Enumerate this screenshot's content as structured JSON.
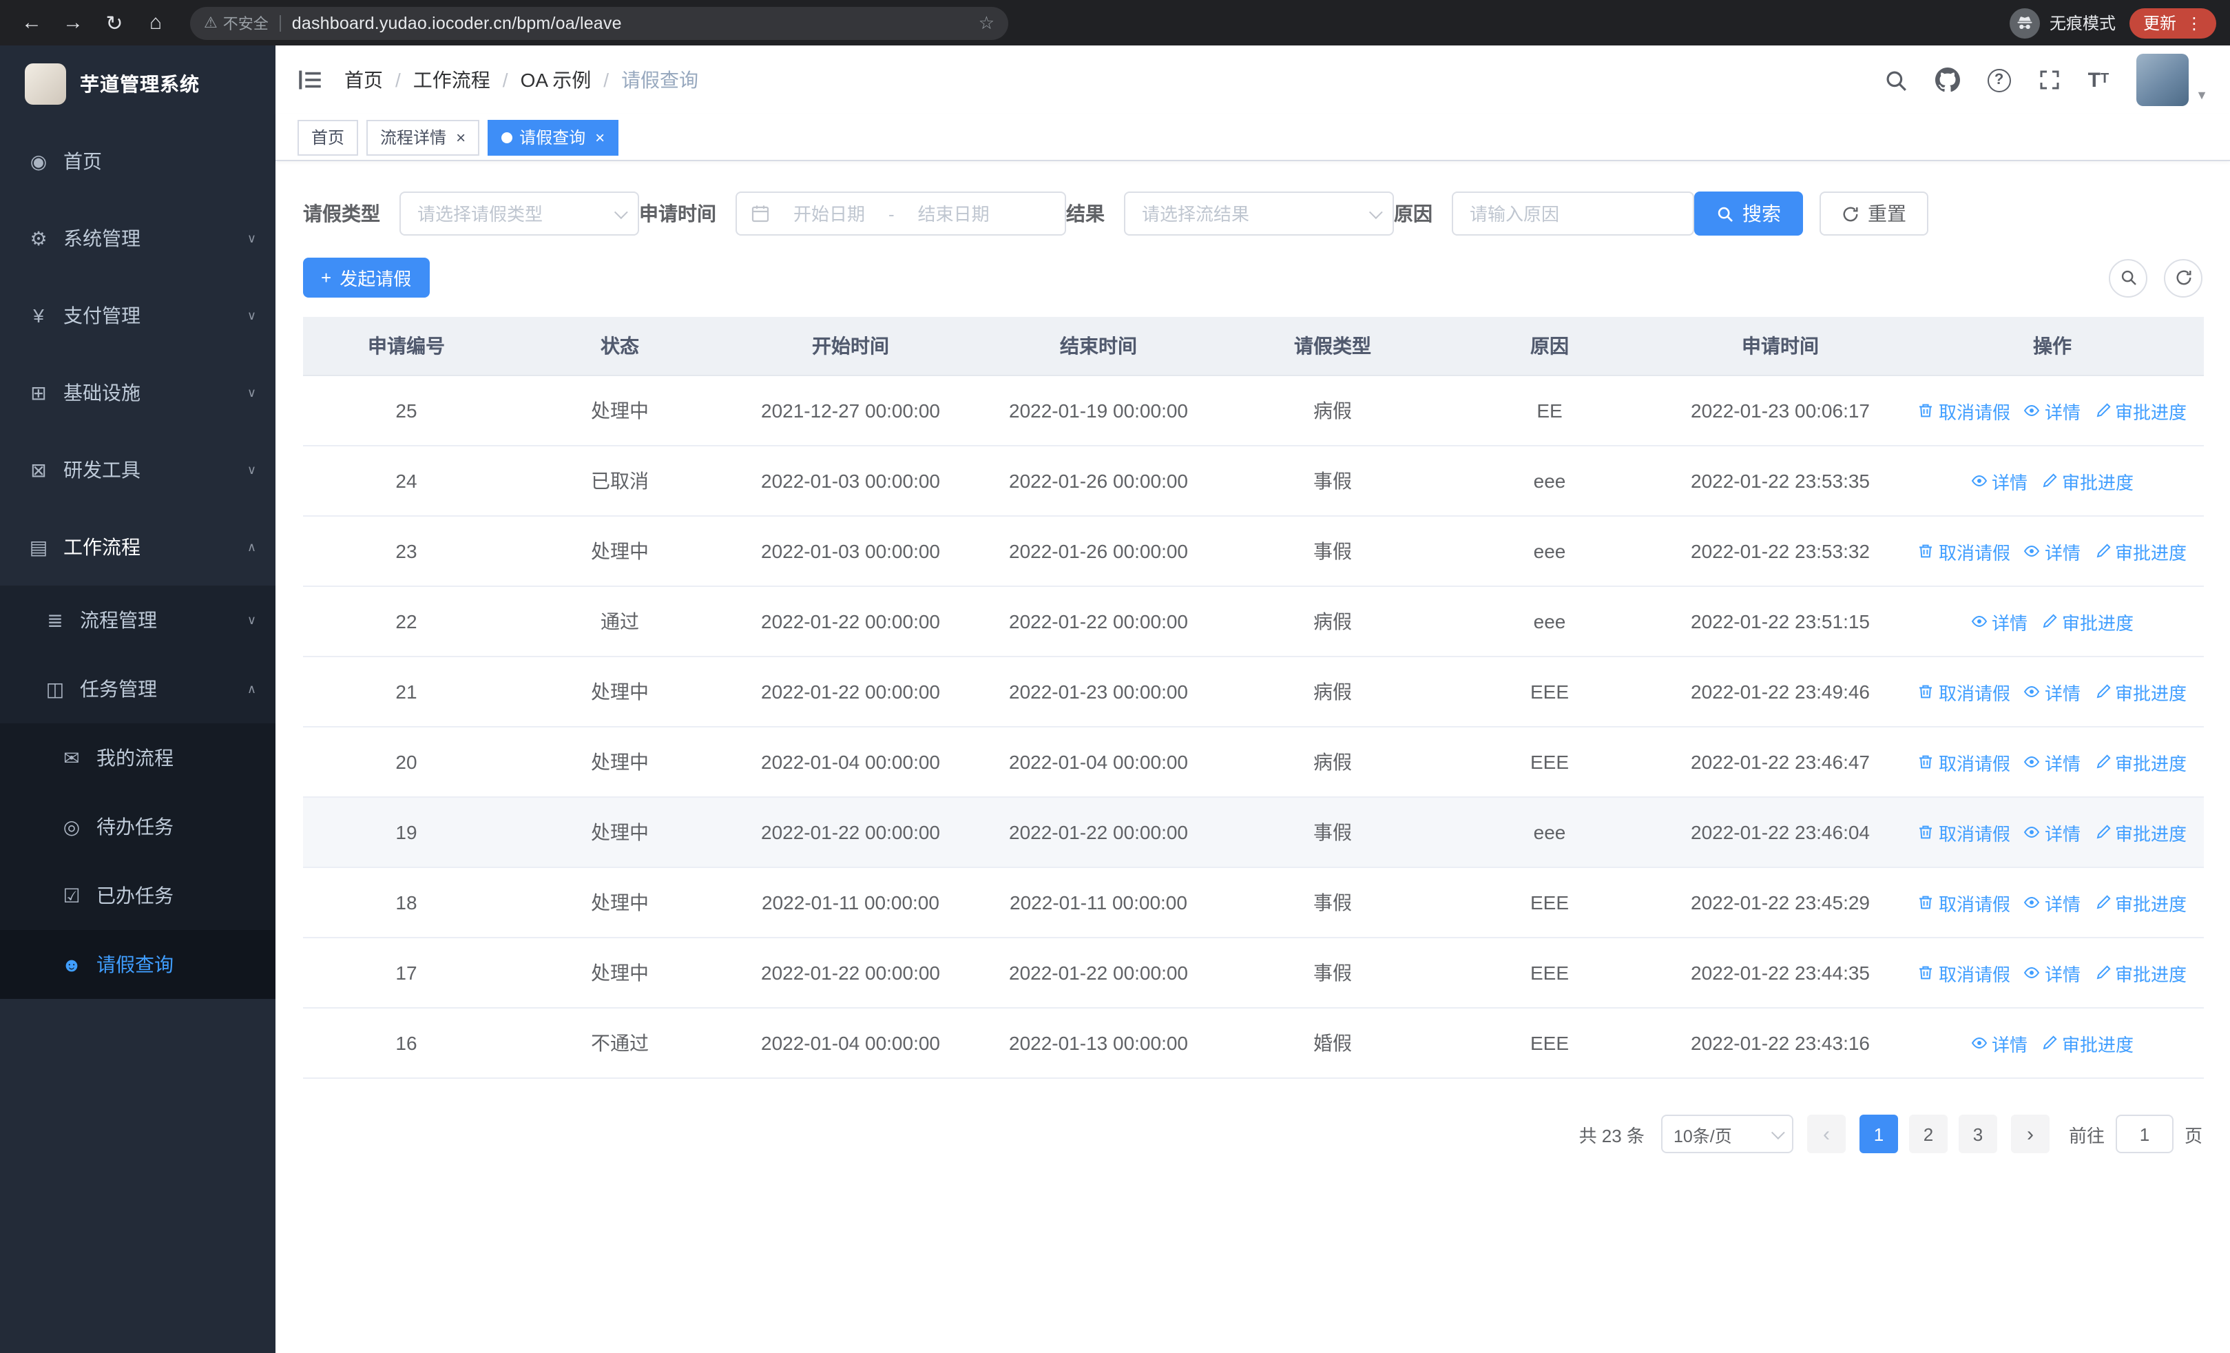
{
  "colors": {
    "primary": "#3e8ef7",
    "link": "#409eff",
    "sidebar_bg": "#232b38"
  },
  "browser": {
    "back_icon": "←",
    "forward_icon": "→",
    "reload_icon": "↻",
    "home_icon": "⌂",
    "security_label": "不安全",
    "url": "dashboard.yudao.iocoder.cn/bpm/oa/leave",
    "bookmark_icon": "☆",
    "incognito_label": "无痕模式",
    "update_label": "更新",
    "menu_icon": "⋮"
  },
  "sidebar": {
    "logo_title": "芋道管理系统",
    "menu": [
      {
        "name": "home",
        "label": "首页",
        "icon": "dashboard-icon",
        "level": 1
      },
      {
        "name": "system",
        "label": "系统管理",
        "icon": "gear-icon",
        "level": 1,
        "has_children": true
      },
      {
        "name": "payment",
        "label": "支付管理",
        "icon": "yen-icon",
        "level": 1,
        "has_children": true
      },
      {
        "name": "infrastructure",
        "label": "基础设施",
        "icon": "monitor-icon",
        "level": 1,
        "has_children": true
      },
      {
        "name": "devtools",
        "label": "研发工具",
        "icon": "toolbox-icon",
        "level": 1,
        "has_children": true
      },
      {
        "name": "workflow",
        "label": "工作流程",
        "icon": "briefcase-icon",
        "level": 1,
        "has_children": true,
        "expanded": true
      },
      {
        "name": "process-management",
        "label": "流程管理",
        "icon": "list-icon",
        "level": 2,
        "has_children": true
      },
      {
        "name": "task-management",
        "label": "任务管理",
        "icon": "flow-icon",
        "level": 2,
        "has_children": true,
        "expanded": true
      },
      {
        "name": "my-processes",
        "label": "我的流程",
        "icon": "chat-icon",
        "level": 3
      },
      {
        "name": "todo-tasks",
        "label": "待办任务",
        "icon": "eye-icon",
        "level": 3
      },
      {
        "name": "done-tasks",
        "label": "已办任务",
        "icon": "check-icon",
        "level": 3
      },
      {
        "name": "leave-query",
        "label": "请假查询",
        "icon": "user-icon",
        "level": 3,
        "active": true
      }
    ]
  },
  "navbar": {
    "separator": "/",
    "breadcrumb": [
      {
        "label": "首页"
      },
      {
        "label": "工作流程"
      },
      {
        "label": "OA 示例"
      },
      {
        "label": "请假查询"
      }
    ]
  },
  "tags": [
    {
      "name": "home",
      "label": "首页",
      "closable": false,
      "active": false
    },
    {
      "name": "process-detail",
      "label": "流程详情",
      "closable": true,
      "active": false
    },
    {
      "name": "leave-query",
      "label": "请假查询",
      "closable": true,
      "active": true
    }
  ],
  "filters": {
    "leave_type": {
      "label": "请假类型",
      "placeholder": "请选择请假类型"
    },
    "apply_time": {
      "label": "申请时间",
      "start_placeholder": "开始日期",
      "separator": "-",
      "end_placeholder": "结束日期"
    },
    "result": {
      "label": "结果",
      "placeholder": "请选择流结果"
    },
    "reason": {
      "label": "原因",
      "placeholder": "请输入原因"
    },
    "search_label": "搜索",
    "reset_label": "重置"
  },
  "toolbar": {
    "create_label": "发起请假"
  },
  "table": {
    "columns": [
      "申请编号",
      "状态",
      "开始时间",
      "结束时间",
      "请假类型",
      "原因",
      "申请时间",
      "操作"
    ],
    "action_labels": {
      "cancel": "取消请假",
      "detail": "详情",
      "progress": "审批进度"
    },
    "highlighted_row_id": "19",
    "rows": [
      {
        "id": "25",
        "status": "处理中",
        "start": "2021-12-27 00:00:00",
        "end": "2022-01-19 00:00:00",
        "type": "病假",
        "reason": "EE",
        "apply_time": "2022-01-23 00:06:17",
        "actions": [
          "cancel",
          "detail",
          "progress"
        ]
      },
      {
        "id": "24",
        "status": "已取消",
        "start": "2022-01-03 00:00:00",
        "end": "2022-01-26 00:00:00",
        "type": "事假",
        "reason": "eee",
        "apply_time": "2022-01-22 23:53:35",
        "actions": [
          "detail",
          "progress"
        ]
      },
      {
        "id": "23",
        "status": "处理中",
        "start": "2022-01-03 00:00:00",
        "end": "2022-01-26 00:00:00",
        "type": "事假",
        "reason": "eee",
        "apply_time": "2022-01-22 23:53:32",
        "actions": [
          "cancel",
          "detail",
          "progress"
        ]
      },
      {
        "id": "22",
        "status": "通过",
        "start": "2022-01-22 00:00:00",
        "end": "2022-01-22 00:00:00",
        "type": "病假",
        "reason": "eee",
        "apply_time": "2022-01-22 23:51:15",
        "actions": [
          "detail",
          "progress"
        ]
      },
      {
        "id": "21",
        "status": "处理中",
        "start": "2022-01-22 00:00:00",
        "end": "2022-01-23 00:00:00",
        "type": "病假",
        "reason": "EEE",
        "apply_time": "2022-01-22 23:49:46",
        "actions": [
          "cancel",
          "detail",
          "progress"
        ]
      },
      {
        "id": "20",
        "status": "处理中",
        "start": "2022-01-04 00:00:00",
        "end": "2022-01-04 00:00:00",
        "type": "病假",
        "reason": "EEE",
        "apply_time": "2022-01-22 23:46:47",
        "actions": [
          "cancel",
          "detail",
          "progress"
        ]
      },
      {
        "id": "19",
        "status": "处理中",
        "start": "2022-01-22 00:00:00",
        "end": "2022-01-22 00:00:00",
        "type": "事假",
        "reason": "eee",
        "apply_time": "2022-01-22 23:46:04",
        "actions": [
          "cancel",
          "detail",
          "progress"
        ]
      },
      {
        "id": "18",
        "status": "处理中",
        "start": "2022-01-11 00:00:00",
        "end": "2022-01-11 00:00:00",
        "type": "事假",
        "reason": "EEE",
        "apply_time": "2022-01-22 23:45:29",
        "actions": [
          "cancel",
          "detail",
          "progress"
        ]
      },
      {
        "id": "17",
        "status": "处理中",
        "start": "2022-01-22 00:00:00",
        "end": "2022-01-22 00:00:00",
        "type": "事假",
        "reason": "EEE",
        "apply_time": "2022-01-22 23:44:35",
        "actions": [
          "cancel",
          "detail",
          "progress"
        ]
      },
      {
        "id": "16",
        "status": "不通过",
        "start": "2022-01-04 00:00:00",
        "end": "2022-01-13 00:00:00",
        "type": "婚假",
        "reason": "EEE",
        "apply_time": "2022-01-22 23:43:16",
        "actions": [
          "detail",
          "progress"
        ]
      }
    ]
  },
  "pagination": {
    "total_label": "共 23 条",
    "page_size": "10条/页",
    "prev_icon": "‹",
    "next_icon": "›",
    "pages": [
      "1",
      "2",
      "3"
    ],
    "active_page": "1",
    "goto_prefix": "前往",
    "goto_value": "1",
    "goto_suffix": "页"
  }
}
